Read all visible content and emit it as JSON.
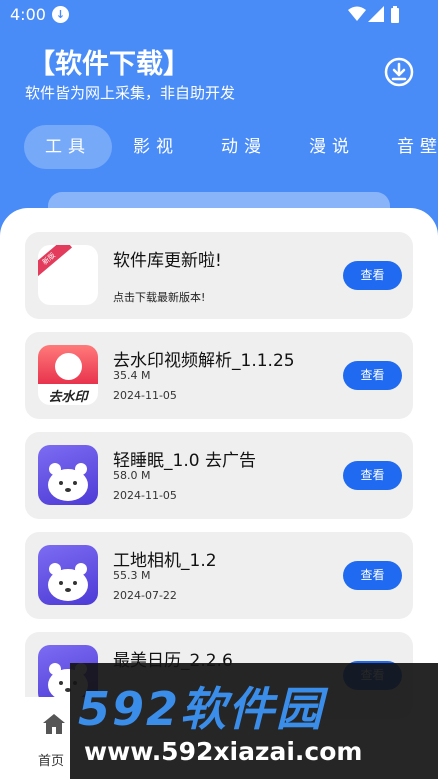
{
  "status_bar": {
    "time": "4:00"
  },
  "header": {
    "title": "【软件下载】",
    "subtitle": "软件皆为网上采集，非自助开发"
  },
  "tabs": [
    {
      "label": "工具",
      "active": true
    },
    {
      "label": "影视",
      "active": false
    },
    {
      "label": "动漫",
      "active": false
    },
    {
      "label": "漫说",
      "active": false
    },
    {
      "label": "音壁",
      "active": false
    }
  ],
  "apps": [
    {
      "name": "软件库更新啦!",
      "note": "点击下载最新版本!",
      "icon": "new-badge-icon",
      "badge": "新版",
      "button": "查看"
    },
    {
      "name": "去水印视频解析_1.1.25",
      "size": "35.4 M",
      "date": "2024-11-05",
      "icon": "watermark-remover-icon",
      "icon_text": "去水印",
      "button": "查看"
    },
    {
      "name": "轻睡眠_1.0 去广告",
      "size": "58.0 M",
      "date": "2024-11-05",
      "icon": "polar-bear-icon",
      "button": "查看"
    },
    {
      "name": "工地相机_1.2",
      "size": "55.3 M",
      "date": "2024-07-22",
      "icon": "polar-bear-icon",
      "button": "查看"
    },
    {
      "name": "最美日历_2.2.6",
      "icon": "polar-bear-icon",
      "button": "查看"
    }
  ],
  "bottom_nav": {
    "home_label": "首页"
  },
  "watermark": {
    "brand": "592软件园",
    "url": "www.592xiazai.com"
  },
  "colors": {
    "header_bg": "#4a8cf7",
    "button": "#1f6af0",
    "card_bg": "#efefef"
  }
}
